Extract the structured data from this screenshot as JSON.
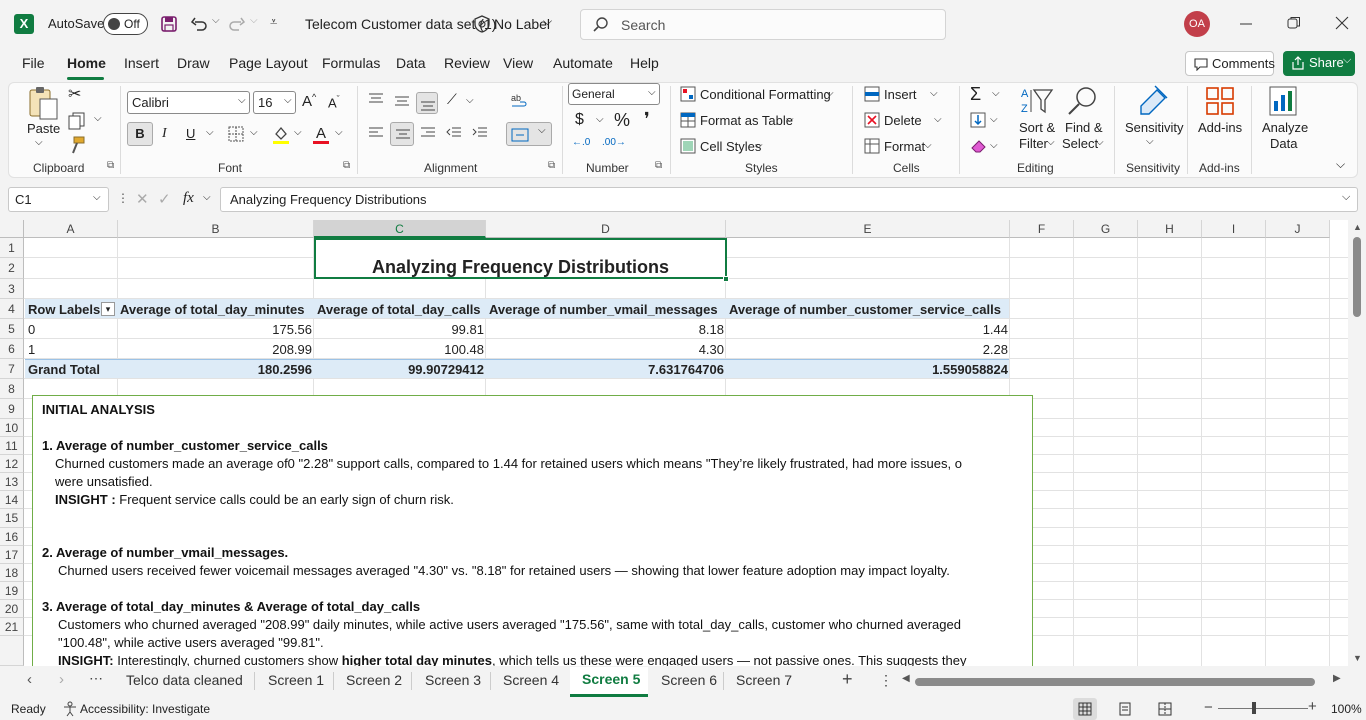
{
  "titlebar": {
    "autosave_label": "AutoSave",
    "autosave_state": "Off",
    "doc_title": "Telecom Customer data set (1)",
    "label_status": "No Label",
    "search_placeholder": "Search",
    "user_initials": "OA"
  },
  "menu": {
    "items": [
      "File",
      "Home",
      "Insert",
      "Draw",
      "Page Layout",
      "Formulas",
      "Data",
      "Review",
      "View",
      "Automate",
      "Help"
    ],
    "active": "Home",
    "comments": "Comments",
    "share": "Share"
  },
  "ribbon": {
    "clipboard": {
      "label": "Clipboard",
      "paste": "Paste"
    },
    "font": {
      "label": "Font",
      "name": "Calibri",
      "size": "16",
      "bold": "B",
      "italic": "I",
      "underline": "U"
    },
    "alignment": {
      "label": "Alignment"
    },
    "number": {
      "label": "Number",
      "format": "General"
    },
    "styles": {
      "label": "Styles",
      "conditional": "Conditional Formatting",
      "format_table": "Format as Table",
      "cell_styles": "Cell Styles"
    },
    "cells": {
      "label": "Cells",
      "insert": "Insert",
      "delete": "Delete",
      "format": "Format"
    },
    "editing": {
      "label": "Editing",
      "sort_filter_1": "Sort &",
      "sort_filter_2": "Filter",
      "find_select_1": "Find &",
      "find_select_2": "Select"
    },
    "sensitivity": {
      "label": "Sensitivity",
      "btn": "Sensitivity"
    },
    "addins": {
      "label": "Add-ins",
      "btn": "Add-ins"
    },
    "analyze": {
      "btn_1": "Analyze",
      "btn_2": "Data"
    }
  },
  "formula_bar": {
    "name_box": "C1",
    "fx": "fx",
    "content": "Analyzing Frequency Distributions"
  },
  "columns": [
    "A",
    "B",
    "C",
    "D",
    "E",
    "F",
    "G",
    "H",
    "I",
    "J"
  ],
  "rows": [
    "1",
    "2",
    "3",
    "4",
    "5",
    "6",
    "7",
    "8",
    "9",
    "10",
    "11",
    "12",
    "13",
    "14",
    "15",
    "16",
    "17",
    "18",
    "19",
    "20",
    "21"
  ],
  "sheet": {
    "title": "Analyzing Frequency Distributions",
    "pivot": {
      "headers": [
        "Row Labels",
        "Average of total_day_minutes",
        "Average of total_day_calls",
        "Average of number_vmail_messages",
        "Average of number_customer_service_calls"
      ],
      "rows": [
        [
          "0",
          "175.56",
          "99.81",
          "8.18",
          "1.44"
        ],
        [
          "1",
          "208.99",
          "100.48",
          "4.30",
          "2.28"
        ]
      ],
      "total": [
        "Grand Total",
        "180.2596",
        "99.90729412",
        "7.631764706",
        "1.559058824"
      ]
    },
    "textbox": {
      "heading": "INITIAL ANALYSIS",
      "s1_title": "1. Average of number_customer_service_calls",
      "s1_l1": "Churned customers made an average of0 \"2.28\"  support calls, compared to 1.44 for retained users which means \"They’re likely frustrated, had more issues, o",
      "s1_l2": "were  unsatisfied.",
      "s1_insight_label": "INSIGHT :",
      "s1_insight": " Frequent service calls could be an early sign of churn risk.",
      "s2_title_num": "2. ",
      "s2_title": "Average of number_vmail_messages.",
      "s2_l1": "Churned users received fewer voicemail messages averaged \"4.30\" vs. \"8.18\" for retained users — showing that lower feature adoption may impact loyalty.",
      "s3_title": "3. Average of total_day_minutes & Average of total_day_calls",
      "s3_l1": "Customers who churned averaged \"208.99\" daily minutes, while active users averaged \"175.56\", same with total_day_calls, customer who churned averaged",
      "s3_l2": "\"100.48\", while active users averaged \"99.81\".",
      "s3_insight_label": "INSIGHT:",
      "s3_insight_a": " Interestingly, churned customers show ",
      "s3_insight_bold": "higher total day minutes",
      "s3_insight_b": ", which tells us these were engaged users — not passive ones. This suggests they"
    }
  },
  "tabs": {
    "sheets": [
      "Telco data cleaned",
      "Screen 1",
      "Screen 2",
      "Screen 3",
      "Screen 4",
      "Screen 5",
      "Screen 6",
      "Screen 7"
    ],
    "active": "Screen 5"
  },
  "status": {
    "ready": "Ready",
    "accessibility": "Accessibility: Investigate",
    "zoom": "100%"
  },
  "colors": {
    "accent": "#107c41",
    "pivot_header": "#ddebf7",
    "textbox_border": "#70ad47"
  }
}
